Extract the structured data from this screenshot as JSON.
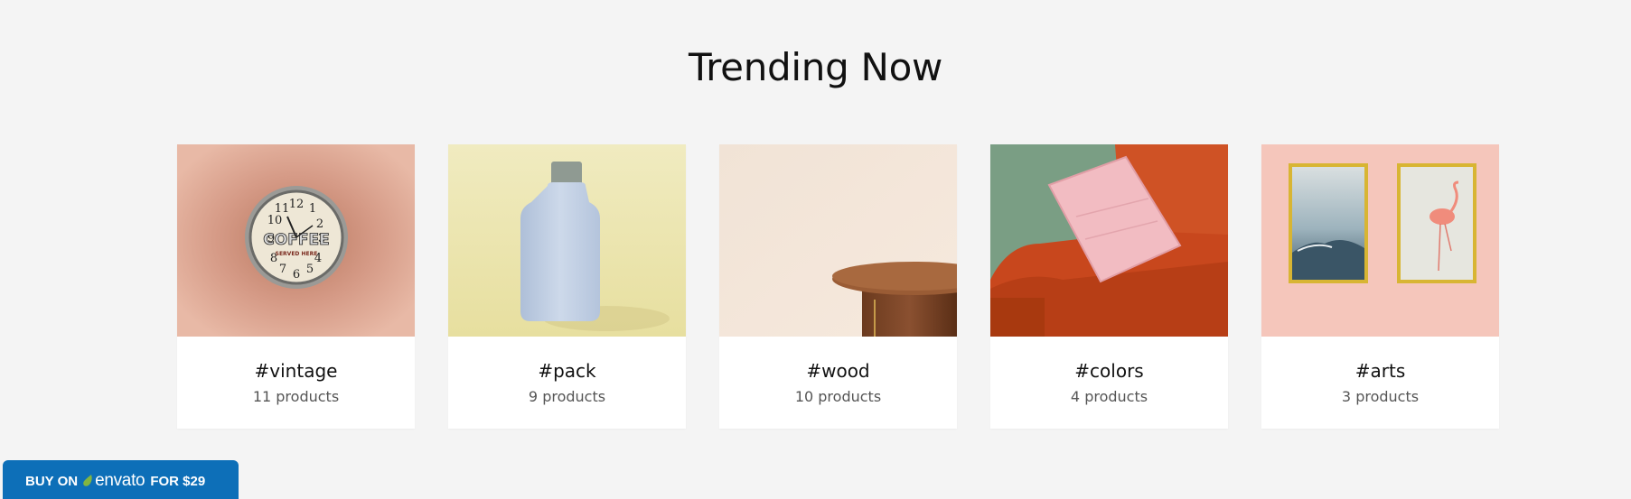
{
  "section": {
    "title": "Trending Now"
  },
  "cards": [
    {
      "tag": "#vintage",
      "count": "11 products",
      "image": "vintage-coffee-clock-image"
    },
    {
      "tag": "#pack",
      "count": "9 products",
      "image": "blue-flask-bottle-image"
    },
    {
      "tag": "#wood",
      "count": "10 products",
      "image": "wooden-side-table-image"
    },
    {
      "tag": "#colors",
      "count": "4 products",
      "image": "orange-sofa-pink-pillow-image"
    },
    {
      "tag": "#arts",
      "count": "3 products",
      "image": "framed-wall-art-image"
    }
  ],
  "clock_text": {
    "line1": "COFFEE",
    "line2": "SERVED HERE"
  },
  "buy": {
    "prefix": "BUY ON",
    "brand": "envato",
    "suffix": "FOR $29",
    "color": "#0d6fb8",
    "leaf_color": "#82b541"
  }
}
